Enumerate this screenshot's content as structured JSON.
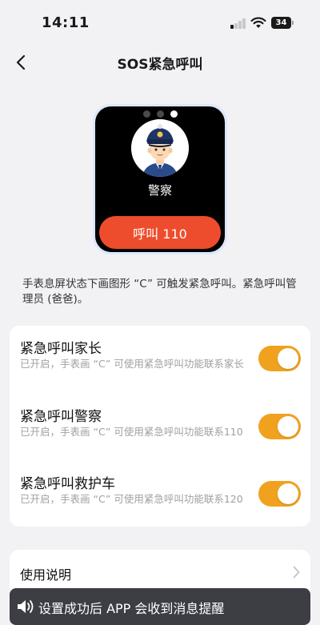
{
  "status_bar": {
    "time": "14:11",
    "battery": "34"
  },
  "nav": {
    "title": "SOS紧急呼叫",
    "back_icon": "chevron-left-icon"
  },
  "watch_preview": {
    "page_count": 3,
    "active_page": 3,
    "contact_name": "警察",
    "call_button_label": "呼叫 110",
    "call_button_color": "#ee4d2d",
    "avatar_icon": "police-officer-avatar"
  },
  "description": "手表息屏状态下画图形 “C” 可触发紧急呼叫。紧急呼叫管理员 (爸爸)。",
  "settings": [
    {
      "title": "紧急呼叫家长",
      "desc": "已开启，手表画 “C” 可使用紧急呼叫功能联系家长",
      "enabled": true
    },
    {
      "title": "紧急呼叫警察",
      "desc": "已开启，手表画 “C” 可使用紧急呼叫功能联系110",
      "enabled": true
    },
    {
      "title": "紧急呼叫救护车",
      "desc": "已开启，手表画 “C” 可使用紧急呼叫功能联系120",
      "enabled": true
    }
  ],
  "toggle_color": "#f0a21f",
  "instructions": {
    "label": "使用说明"
  },
  "toast": {
    "text": "设置成功后 APP 会收到消息提醒",
    "icon": "speaker-icon"
  }
}
